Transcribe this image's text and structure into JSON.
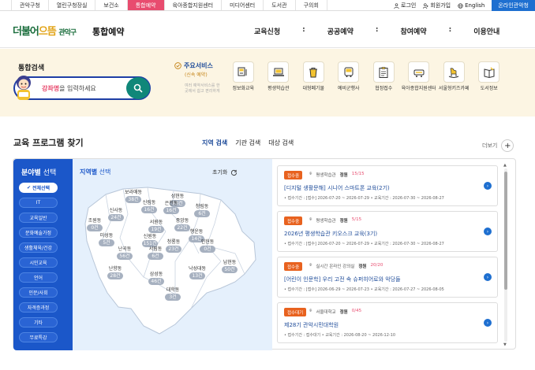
{
  "topnav": {
    "tabs": [
      "관악구청",
      "열린구청장실",
      "보건소",
      "통합예약",
      "육아종합지원센터",
      "미디어센터",
      "도서관",
      "구의회"
    ],
    "active_index": 3,
    "util": {
      "login": "로그인",
      "join": "회원가입",
      "lang": "English",
      "cta": "온라인관악청"
    }
  },
  "header": {
    "logo_main": "더불어",
    "logo_mid": "으뜸",
    "logo_sub": "관악구",
    "service_title": "통합예약",
    "menu": [
      "교육신청",
      "공공예약",
      "참여예약",
      "이용안내"
    ],
    "separator": ":"
  },
  "search": {
    "label": "통합검색",
    "placeholder_keyword": "강좌명",
    "placeholder_rest": "을 입력하세요"
  },
  "services": {
    "title": "주요서비스",
    "subtitle": "(신속 예약)",
    "desc": "여러 예약서비스를 한 곳에서 쉽고 편리하게",
    "items": [
      {
        "label": "정보화교육",
        "icon": "computer-icon"
      },
      {
        "label": "평생학습관",
        "icon": "laptop-icon"
      },
      {
        "label": "대형폐기물",
        "icon": "trash-icon"
      },
      {
        "label": "예비군행사",
        "icon": "bus-icon"
      },
      {
        "label": "협정접수",
        "icon": "clipboard-icon"
      },
      {
        "label": "육아종합지원센터",
        "icon": "stroller-icon"
      },
      {
        "label": "서울형키즈카페",
        "icon": "rocking-horse-icon"
      },
      {
        "label": "도서정보",
        "icon": "book-icon"
      }
    ]
  },
  "program": {
    "title": "교육 프로그램 찾기",
    "tabs": [
      "지역 검색",
      "기관 검색",
      "대상 검색"
    ],
    "active_tab": 0,
    "more": "더보기"
  },
  "field": {
    "title_bold": "분야별",
    "title_rest": " 선택",
    "items": [
      "전체선택",
      "IT",
      "교육일반",
      "문화예술가정",
      "생활체육/건강",
      "시민교육",
      "언어",
      "인문/사회",
      "자격증과정",
      "기타",
      "무료특강"
    ]
  },
  "region": {
    "title_bold": "지역별",
    "title_rest": " 선택",
    "reset": "초기화",
    "districts": [
      {
        "name": "보라매동",
        "count": "38건"
      },
      {
        "name": "성현동",
        "count": "83건"
      },
      {
        "name": "신림동",
        "count": "16건"
      },
      {
        "name": "은천동",
        "count": "16건"
      },
      {
        "name": "청림동",
        "count": "6건"
      },
      {
        "name": "신사동",
        "count": "24건"
      },
      {
        "name": "조원동",
        "count": "0건"
      },
      {
        "name": "서원동",
        "count": "19건"
      },
      {
        "name": "중앙동",
        "count": "22건"
      },
      {
        "name": "행운동",
        "count": "14건"
      },
      {
        "name": "미성동",
        "count": "5건"
      },
      {
        "name": "신원동",
        "count": "151건"
      },
      {
        "name": "청룡동",
        "count": "23건"
      },
      {
        "name": "인헌동",
        "count": "0건"
      },
      {
        "name": "난곡동",
        "count": "56건"
      },
      {
        "name": "서림동",
        "count": "6건"
      },
      {
        "name": "남현동",
        "count": "50건"
      },
      {
        "name": "난향동",
        "count": "28건"
      },
      {
        "name": "낙성대동",
        "count": "13건"
      },
      {
        "name": "삼성동",
        "count": "46건"
      },
      {
        "name": "대학동",
        "count": "3건"
      }
    ]
  },
  "programs": [
    {
      "status": "접수중",
      "place": "평생학습관",
      "cap_label": "정원",
      "cap": "15/15",
      "title": "[디지털 생활문해] 시니어 스마트폰 교육(2기)",
      "period": "• 접수기간 : [접수] 2026-07-20 ~ 2026-07-29    • 교육기간 : 2026-07-30 ~ 2026-08-27"
    },
    {
      "status": "접수중",
      "place": "평생학습관",
      "cap_label": "정원",
      "cap": "5/15",
      "title": "2026년 평생학습관 키오스크 교육(3기)",
      "period": "• 접수기간 : [접수] 2026-07-20 ~ 2026-07-29    • 교육기간 : 2026-07-30 ~ 2026-08-27"
    },
    {
      "status": "접수중",
      "place": "실시간 온라인 강의실",
      "cap_label": "정원",
      "cap": "20/20",
      "title": "[어린이 인문학] 우리 고전 속 슈퍼히어로와 악당들",
      "period": "• 접수기간 : [접수] 2026-06-29 ~ 2026-07-23    • 교육기간 : 2026-07-27 ~ 2026-08-05"
    },
    {
      "status": "접수대기",
      "place": "서울대학교",
      "cap_label": "정원",
      "cap": "0/45",
      "title": "제28기 관악시민대학원",
      "period": "• 접수기간 : 접수대기    • 교육기간 : 2026-08-20 ~ 2026-12-10"
    }
  ],
  "colors": {
    "accent": "#e84c6f",
    "brand_blue": "#1b57c9",
    "brand_green": "#1b6e3d",
    "hero_bg": "#fcf5e3",
    "badge": "#e8621f"
  }
}
